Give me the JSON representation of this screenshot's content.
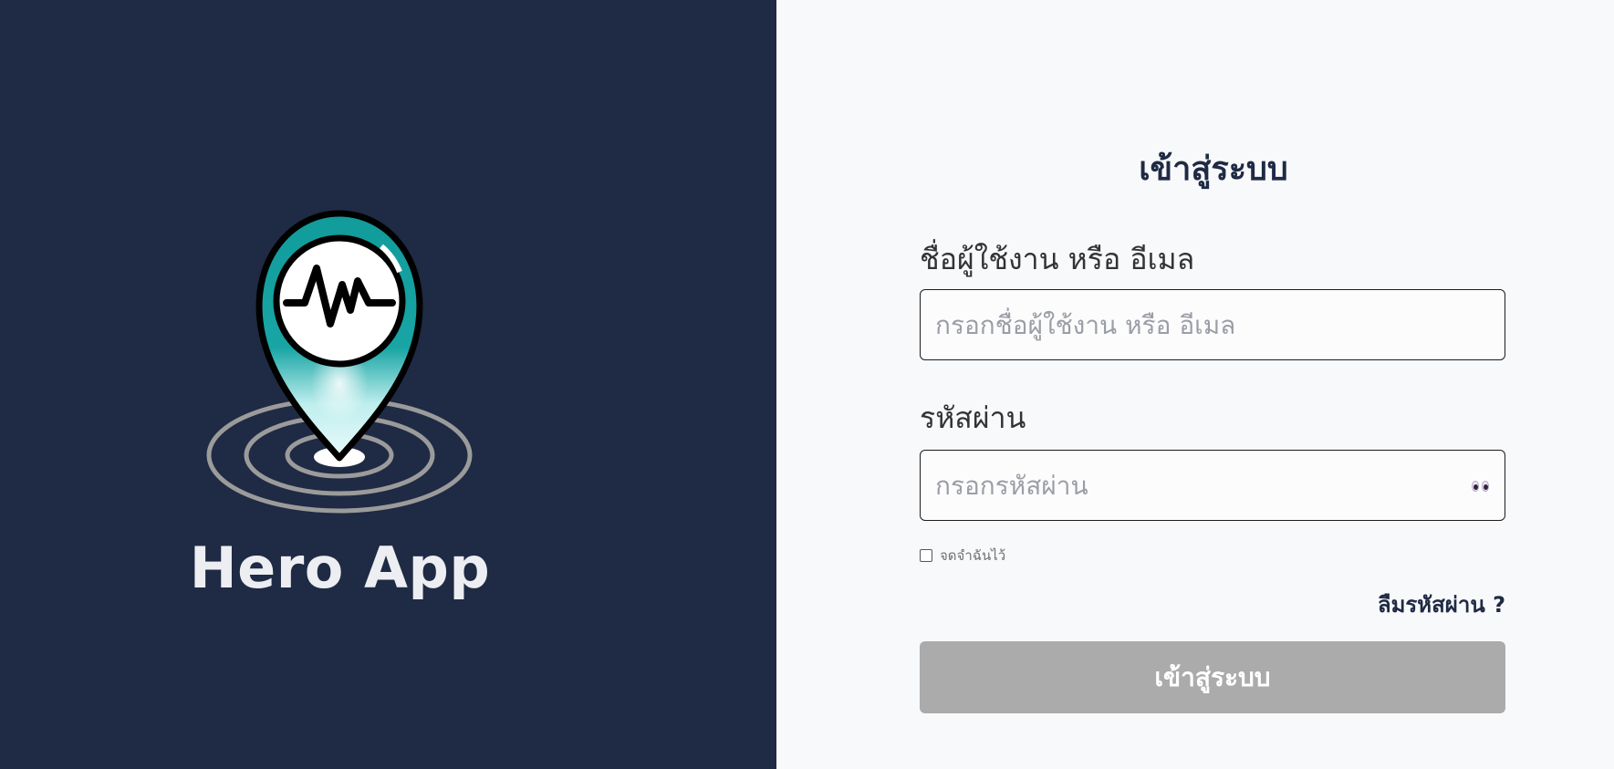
{
  "brand": {
    "app_name": "Hero App",
    "logo_icon": "location-pin-heartbeat-icon",
    "panel_color": "#1f2a44",
    "accent_color": "#119b9b"
  },
  "login": {
    "title": "เข้าสู่ระบบ",
    "username_label": "ชื่อผู้ใช้งาน หรือ อีเมล",
    "username_placeholder": "กรอกชื่อผู้ใช้งาน หรือ อีเมล",
    "username_value": "",
    "password_label": "รหัสผ่าน",
    "password_placeholder": "กรอกรหัสผ่าน",
    "password_value": "",
    "password_toggle_icon": "eyes-icon",
    "remember_label": "จดจำฉันไว้",
    "remember_checked": false,
    "forgot_password_label": "ลืมรหัสผ่าน ?",
    "submit_label": "เข้าสู่ระบบ",
    "submit_color": "#acabac"
  }
}
